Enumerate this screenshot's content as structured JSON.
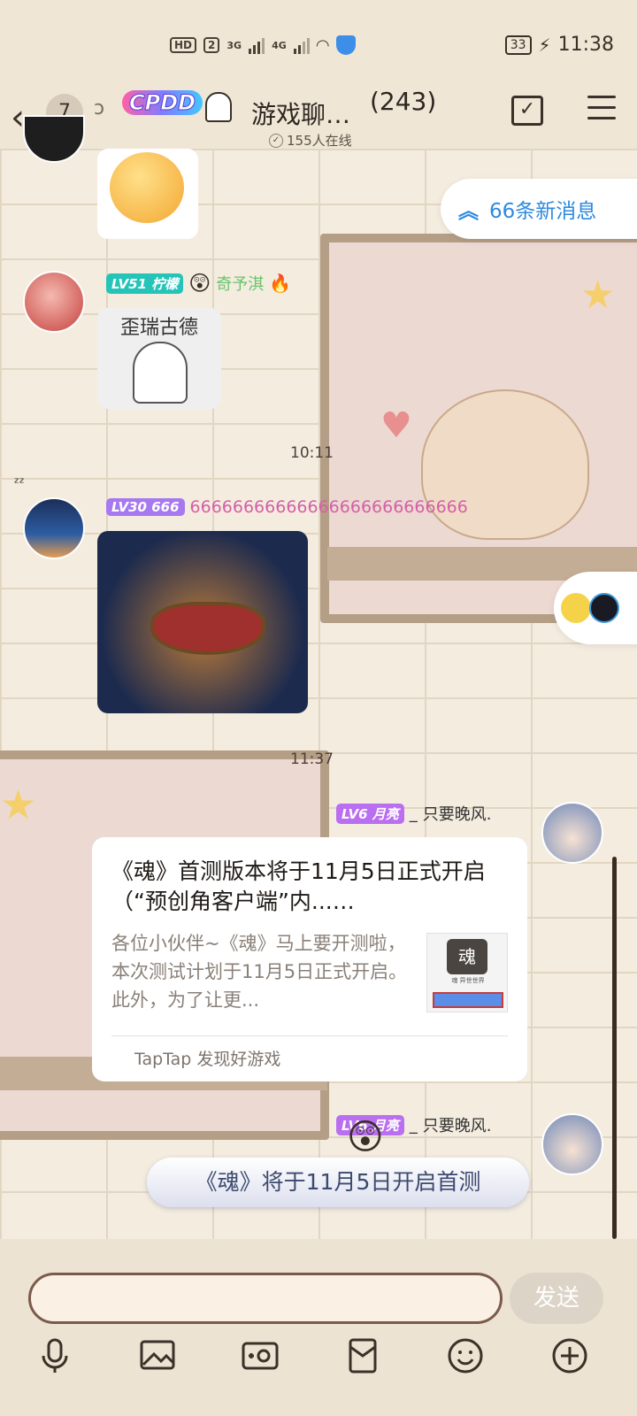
{
  "status_bar": {
    "network_hd": "HD",
    "sim_slot": "2",
    "net_1": "3G",
    "net_2": "4G",
    "battery": "33",
    "time": "11:38"
  },
  "header": {
    "unread_count": "7",
    "group_badge": "CPDD",
    "title": "游戏聊…",
    "member_count": "(243)",
    "online": "155人在线"
  },
  "new_messages_label": "66条新消息",
  "messages": [
    {
      "level": "LV51",
      "name": "柠檬",
      "tag": "奇予淇",
      "sticker_text": "歪瑞古德"
    },
    {
      "time": "10:11"
    },
    {
      "level": "LV30",
      "name": "666",
      "text": "66666666666666666666666666"
    },
    {
      "time": "11:37"
    },
    {
      "level": "LV6",
      "name": "月亮",
      "separator": "_",
      "sender": "只要晚风.",
      "card": {
        "title": "《魂》首测版本将于11月5日正式开启（“预创角客户端”内...…",
        "description": "各位小伙伴~《魂》马上要开测啦，本次测试计划于11月5日正式开启。此外，为了让更...",
        "thumb_logo": "魂",
        "thumb_caption": "魂 异世世界",
        "source": "TapTap 发现好游戏"
      }
    },
    {
      "level": "LV6",
      "name": "月亮",
      "separator": "_",
      "sender": "只要晚风.",
      "text": "《魂》将于11月5日开启首测"
    }
  ],
  "input": {
    "placeholder": "",
    "send_label": "发送"
  },
  "toolbar_icons": [
    "microphone-icon",
    "image-icon",
    "camera-icon",
    "red-packet-icon",
    "emoji-icon",
    "plus-icon"
  ],
  "colors": {
    "accent_blue": "#2d8ae0",
    "lv51_badge": "#25c4b8",
    "lv30_badge": "#a779f0",
    "lv6_badge": "#b96ff0"
  }
}
